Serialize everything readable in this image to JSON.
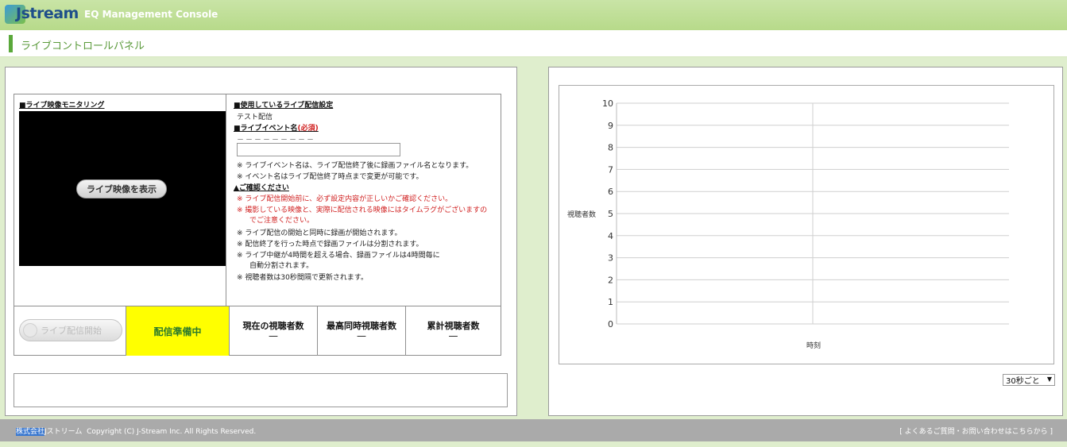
{
  "header": {
    "logo_text": "Jstream",
    "app_title": "EQ Management Console"
  },
  "page": {
    "title": "ライブコントロールパネル"
  },
  "monitor": {
    "title": "■ライブ映像モニタリング",
    "show_button": "ライブ映像を表示"
  },
  "settings": {
    "title": "■使用しているライブ配信設定",
    "value": "テスト配信",
    "event_name_label": "■ライブイベント名",
    "required_label": "(必須)",
    "event_name_value": "－－－－－－－－－",
    "event_name_input": "",
    "notes": [
      "※ ライブイベント名は、ライブ配信終了後に録画ファイル名となります。",
      "※ イベント名はライブ配信終了時点まで変更が可能です。"
    ],
    "confirm_title": "▲ご確認ください",
    "warnings": [
      "※ ライブ配信開始前に、必ず設定内容が正しいかご確認ください。",
      "※ 撮影している映像と、実際に配信される映像にはタイムラグがございますの",
      "でご注意ください。"
    ],
    "info": [
      "※ ライブ配信の開始と同時に録画が開始されます。",
      "※ 配信終了を行った時点で録画ファイルは分割されます。",
      "※ ライブ中継が4時間を超える場合、録画ファイルは4時間毎に",
      "自動分割されます。",
      "※ 視聴者数は30秒間隔で更新されます。"
    ]
  },
  "status": {
    "start_button": "ライブ配信開始",
    "state": "配信準備中",
    "current_viewers_label": "現在の視聴者数",
    "current_viewers_value": "—",
    "peak_viewers_label": "最高同時視聴者数",
    "peak_viewers_value": "—",
    "total_viewers_label": "累計視聴者数",
    "total_viewers_value": "—"
  },
  "chart_data": {
    "type": "line",
    "xlabel": "時刻",
    "ylabel": "視聴者数",
    "ylim": [
      0,
      10
    ],
    "yticks": [
      "0",
      "1",
      "2",
      "3",
      "4",
      "5",
      "6",
      "7",
      "8",
      "9",
      "10"
    ],
    "categories": [],
    "series": [],
    "grid": true
  },
  "controls": {
    "interval": "30秒ごと"
  },
  "footer": {
    "company_highlight": "株式会社",
    "company_rest": "Jストリーム",
    "copyright": "Copyright (C) J-Stream Inc. All Rights Reserved.",
    "help_link": "[ よくあるご質問・お問い合わせはこちらから ]"
  },
  "colors": {
    "accent": "#5aa83a",
    "status_bg": "#ffff00"
  }
}
